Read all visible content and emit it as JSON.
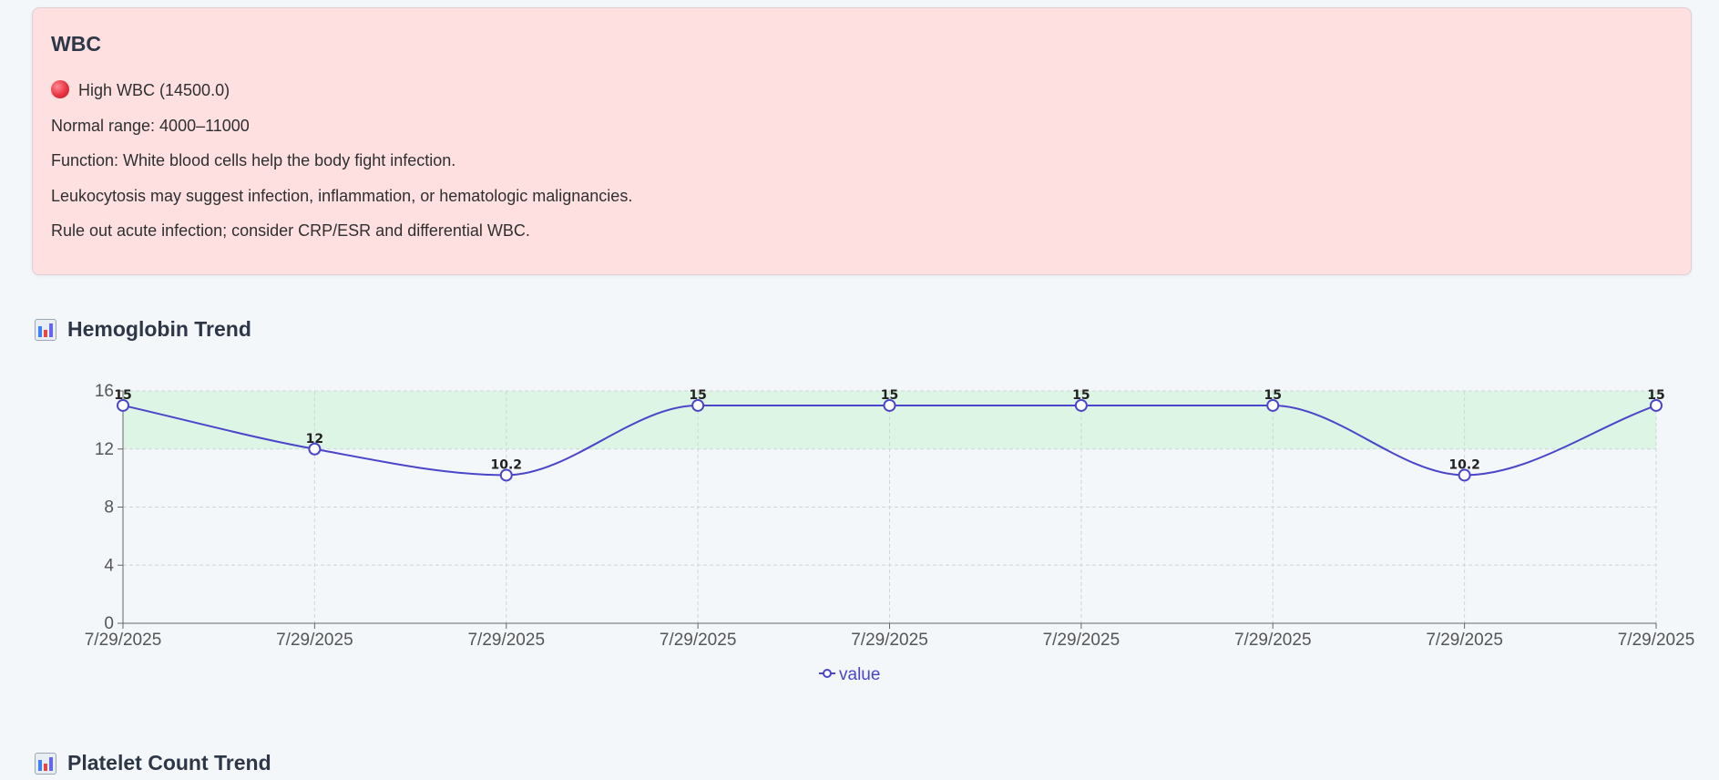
{
  "alert": {
    "title": "WBC",
    "status": "High WBC (14500.0)",
    "normal_range": "Normal range: 4000–11000",
    "function": "Function: White blood cells help the body fight infection.",
    "interpretation": "Leukocytosis may suggest infection, inflammation, or hematologic malignancies.",
    "recommendation": "Rule out acute infection; consider CRP/ESR and differential WBC.",
    "status_icon": "red-circle-icon",
    "background_color": "#fee0e1"
  },
  "sections": {
    "hemoglobin_title": "Hemoglobin Trend",
    "platelet_title": "Platelet Count Trend",
    "section_icon": "bar-chart-icon"
  },
  "chart_data": {
    "type": "line",
    "title": "Hemoglobin Trend",
    "categories": [
      "7/29/2025",
      "7/29/2025",
      "7/29/2025",
      "7/29/2025",
      "7/29/2025",
      "7/29/2025",
      "7/29/2025",
      "7/29/2025",
      "7/29/2025"
    ],
    "series": [
      {
        "name": "value",
        "values": [
          15,
          12,
          10.2,
          15,
          15,
          15,
          15,
          10.2,
          15
        ],
        "color": "#4b45c9"
      }
    ],
    "data_labels": [
      "15",
      "12",
      "10.2",
      "15",
      "15",
      "15",
      "15",
      "10.2",
      "15"
    ],
    "ylim": [
      0,
      16
    ],
    "yticks": [
      0,
      4,
      8,
      12,
      16
    ],
    "reference_band": {
      "min": 12,
      "max": 16,
      "color": "#ddf5e5"
    },
    "grid": true,
    "grid_style": "dashed",
    "legend_position": "bottom-center",
    "curve": "smooth"
  }
}
